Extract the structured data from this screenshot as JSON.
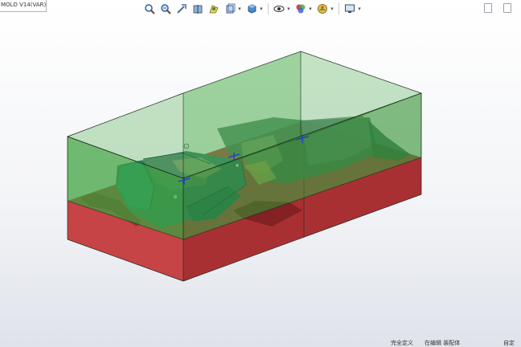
{
  "feature_tree": {
    "tab_label": "MOLD V14(VAR)"
  },
  "heads_up_toolbar": {
    "buttons": [
      {
        "icon": "zoom-to-fit-icon"
      },
      {
        "icon": "zoom-to-area-icon"
      },
      {
        "icon": "previous-view-icon"
      },
      {
        "icon": "section-view-icon"
      },
      {
        "icon": "dynamic-annotation-icon"
      },
      {
        "icon": "view-orientation-icon"
      },
      {
        "icon": "display-style-icon"
      },
      {
        "icon": "hide-show-icon"
      },
      {
        "icon": "edit-appearance-icon"
      },
      {
        "icon": "apply-scene-icon"
      },
      {
        "icon": "view-settings-icon"
      }
    ]
  },
  "status_bar": {
    "left_text": "完全定义",
    "middle_text": "在编辑 装配体",
    "right_text": "自定"
  },
  "colors": {
    "core_block": "#c0393b",
    "cavity_block": "#3aa13a",
    "part_body": "#2f8f88",
    "edge": "#1b2b1b"
  }
}
